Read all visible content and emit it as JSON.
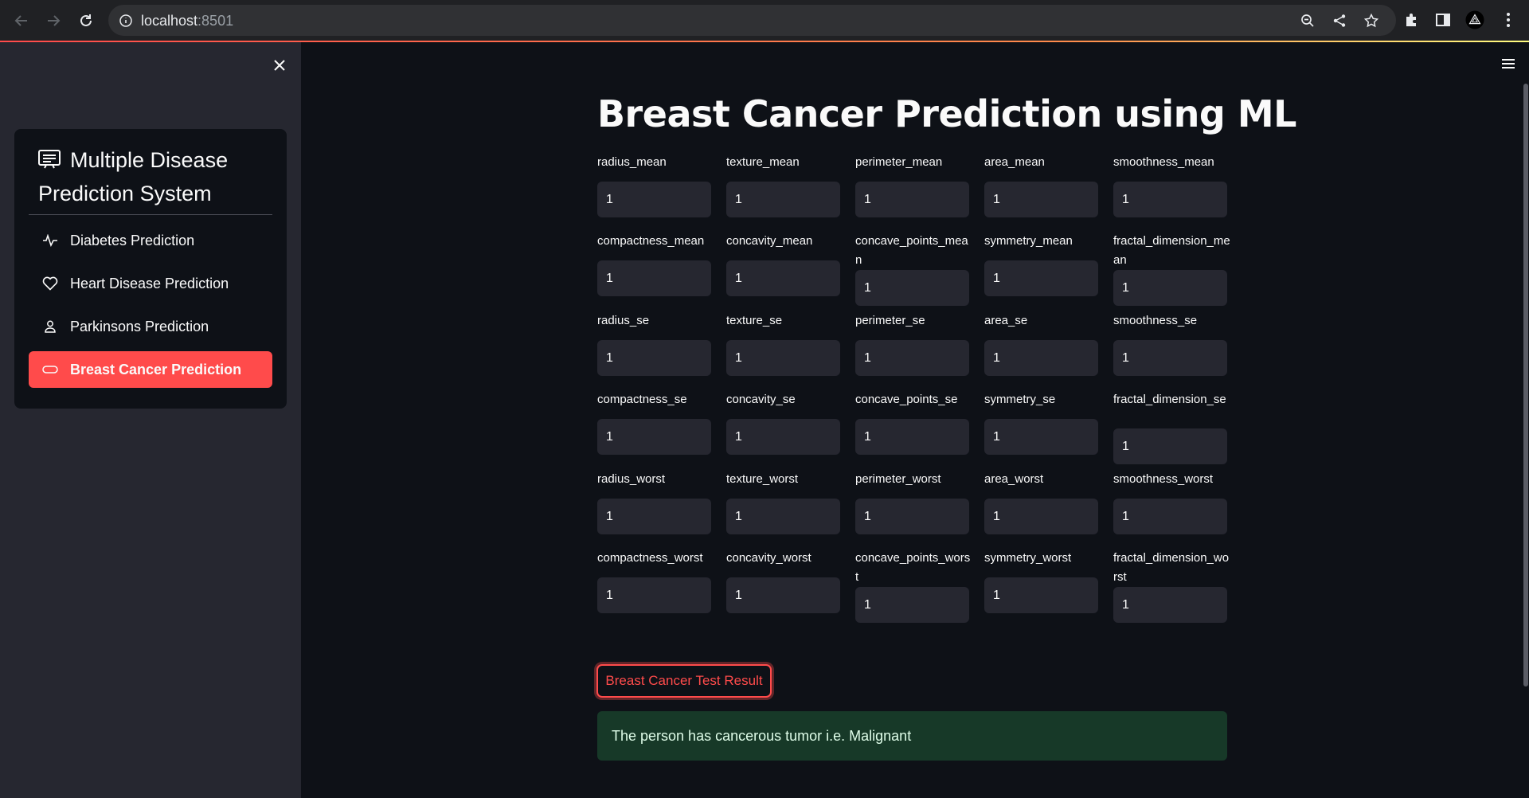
{
  "browser": {
    "url_host": "localhost",
    "url_port": ":8501"
  },
  "sidebar": {
    "title": "Multiple Disease Prediction System",
    "items": [
      {
        "label": "Diabetes Prediction",
        "icon": "activity-icon",
        "active": false
      },
      {
        "label": "Heart Disease Prediction",
        "icon": "heart-icon",
        "active": false
      },
      {
        "label": "Parkinsons Prediction",
        "icon": "person-icon",
        "active": false
      },
      {
        "label": "Breast Cancer Prediction",
        "icon": "capsule-icon",
        "active": true
      }
    ]
  },
  "main": {
    "title": "Breast Cancer Prediction using ML",
    "fields": [
      {
        "label": "radius_mean",
        "value": "1"
      },
      {
        "label": "texture_mean",
        "value": "1"
      },
      {
        "label": "perimeter_mean",
        "value": "1"
      },
      {
        "label": "area_mean",
        "value": "1"
      },
      {
        "label": "smoothness_mean",
        "value": "1"
      },
      {
        "label": "compactness_mean",
        "value": "1"
      },
      {
        "label": "concavity_mean",
        "value": "1"
      },
      {
        "label": "concave_points_mean",
        "value": "1"
      },
      {
        "label": "symmetry_mean",
        "value": "1"
      },
      {
        "label": "fractal_dimension_mean",
        "value": "1"
      },
      {
        "label": "radius_se",
        "value": "1"
      },
      {
        "label": "texture_se",
        "value": "1"
      },
      {
        "label": "perimeter_se",
        "value": "1"
      },
      {
        "label": "area_se",
        "value": "1"
      },
      {
        "label": "smoothness_se",
        "value": "1"
      },
      {
        "label": "compactness_se",
        "value": "1"
      },
      {
        "label": "concavity_se",
        "value": "1"
      },
      {
        "label": "concave_points_se",
        "value": "1"
      },
      {
        "label": "symmetry_se",
        "value": "1"
      },
      {
        "label": "fractal_dimension_se",
        "value": "1"
      },
      {
        "label": "radius_worst",
        "value": "1"
      },
      {
        "label": "texture_worst",
        "value": "1"
      },
      {
        "label": "perimeter_worst",
        "value": "1"
      },
      {
        "label": "area_worst",
        "value": "1"
      },
      {
        "label": "smoothness_worst",
        "value": "1"
      },
      {
        "label": "compactness_worst",
        "value": "1"
      },
      {
        "label": "concavity_worst",
        "value": "1"
      },
      {
        "label": "concave_points_worst",
        "value": "1"
      },
      {
        "label": "symmetry_worst",
        "value": "1"
      },
      {
        "label": "fractal_dimension_worst",
        "value": "1"
      }
    ],
    "button_label": "Breast Cancer Test Result",
    "result_text": "The person has cancerous tumor i.e. Malignant"
  },
  "colors": {
    "accent": "#ff4b4b",
    "background": "#0e1117",
    "sidebar": "#262730",
    "success_bg": "#173928"
  }
}
